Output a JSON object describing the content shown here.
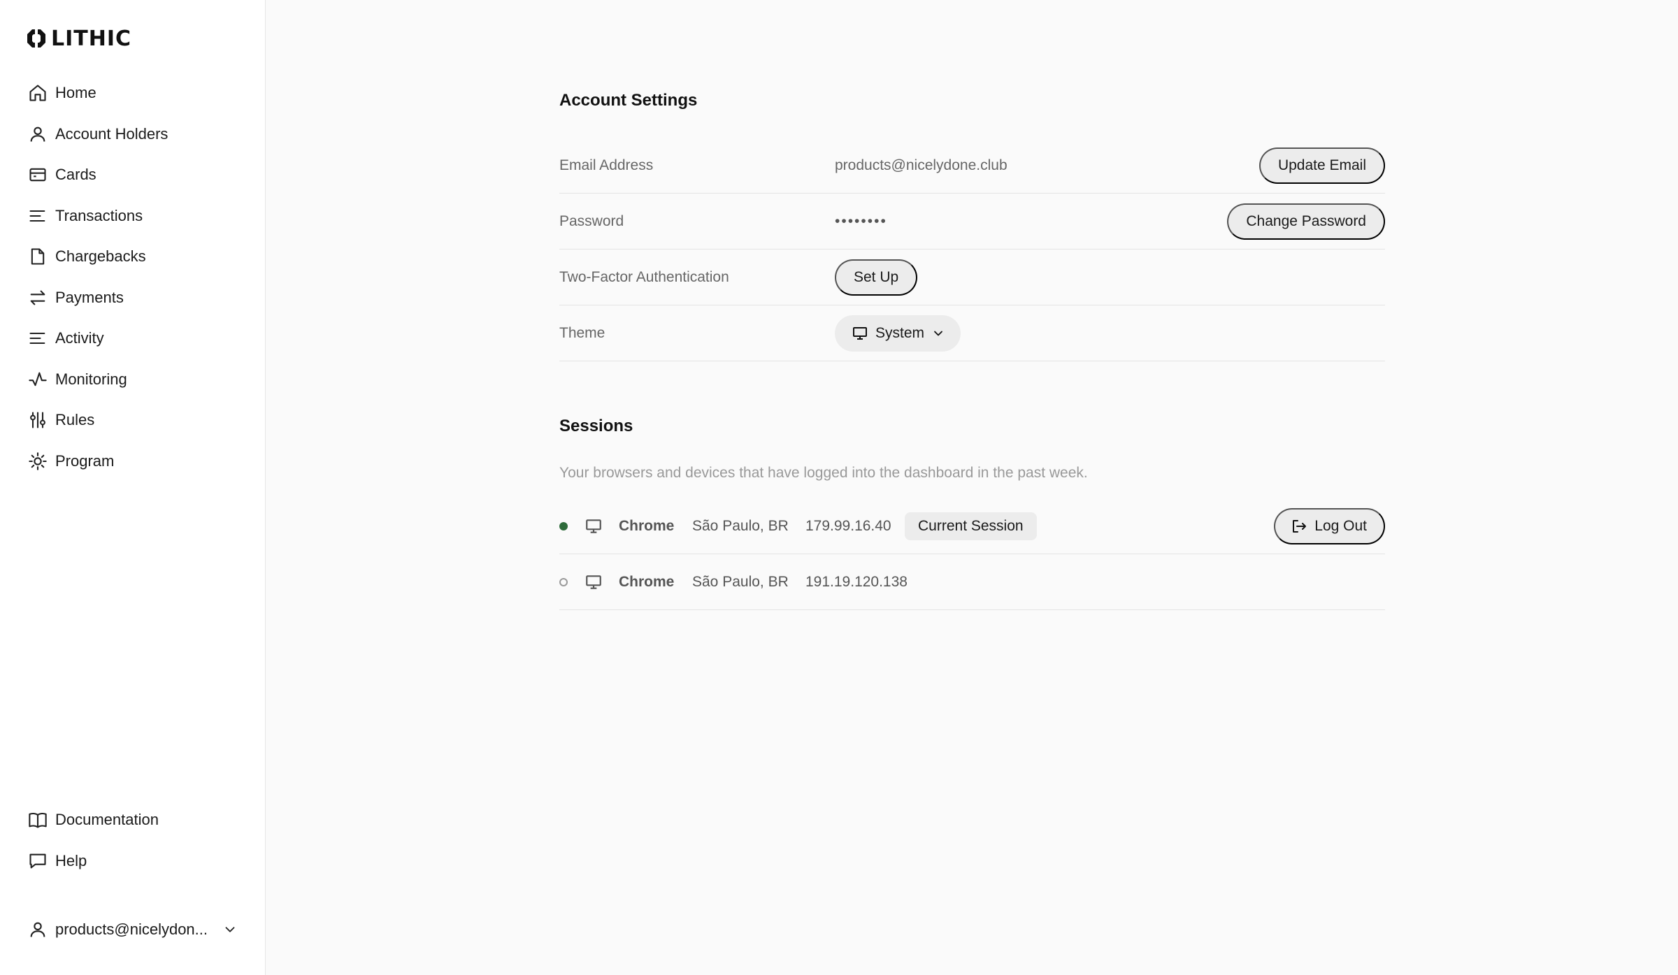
{
  "brand": {
    "name": "LITHIC"
  },
  "nav": {
    "items": [
      {
        "label": "Home",
        "icon": "home-icon"
      },
      {
        "label": "Account Holders",
        "icon": "user-icon"
      },
      {
        "label": "Cards",
        "icon": "card-icon"
      },
      {
        "label": "Transactions",
        "icon": "list-icon"
      },
      {
        "label": "Chargebacks",
        "icon": "file-icon"
      },
      {
        "label": "Payments",
        "icon": "arrows-icon"
      },
      {
        "label": "Activity",
        "icon": "list-icon"
      },
      {
        "label": "Monitoring",
        "icon": "pulse-icon"
      },
      {
        "label": "Rules",
        "icon": "sliders-icon"
      },
      {
        "label": "Program",
        "icon": "gear-icon"
      }
    ],
    "bottom_items": [
      {
        "label": "Documentation",
        "icon": "book-icon"
      },
      {
        "label": "Help",
        "icon": "message-icon"
      }
    ],
    "user_label": "products@nicelydon..."
  },
  "account_settings": {
    "title": "Account Settings",
    "email_label": "Email Address",
    "email_value": "products@nicelydone.club",
    "email_button": "Update Email",
    "password_label": "Password",
    "password_value": "••••••••",
    "password_button": "Change Password",
    "twofa_label": "Two-Factor Authentication",
    "twofa_button": "Set Up",
    "theme_label": "Theme",
    "theme_value": "System"
  },
  "sessions": {
    "title": "Sessions",
    "description": "Your browsers and devices that have logged into the dashboard in the past week.",
    "current_badge": "Current Session",
    "logout_label": "Log Out",
    "items": [
      {
        "browser": "Chrome",
        "location": "São Paulo, BR",
        "ip": "179.99.16.40",
        "status": "active"
      },
      {
        "browser": "Chrome",
        "location": "São Paulo, BR",
        "ip": "191.19.120.138",
        "status": "inactive"
      }
    ]
  },
  "colors": {
    "active_dot": "#2e6b3a",
    "pill_bg": "#ececec",
    "page_bg": "#fafafa"
  }
}
